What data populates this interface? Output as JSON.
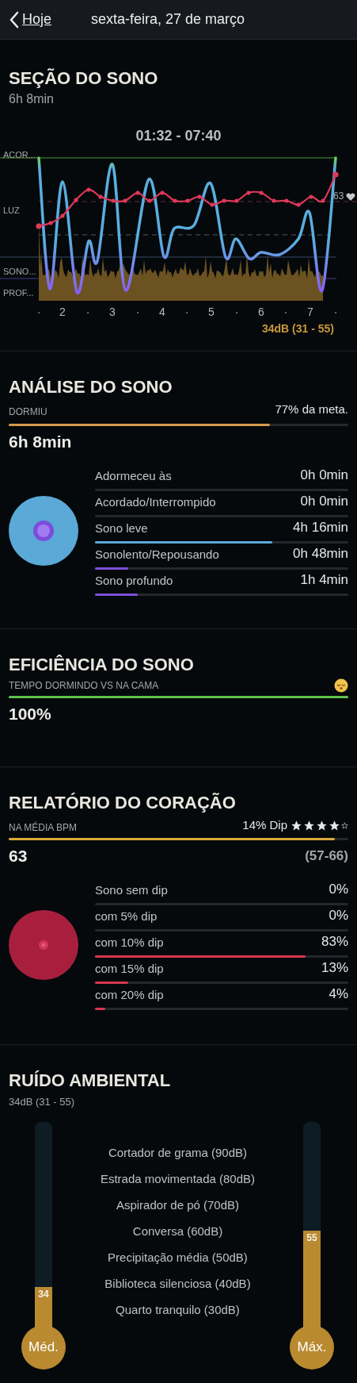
{
  "header": {
    "back_label": "Hoje",
    "title": "sexta-feira, 27 de março"
  },
  "sleep_session": {
    "title": "SEÇÃO DO SONO",
    "duration": "6h 8min",
    "time_range": "01:32 - 07:40",
    "stage_labels": [
      "ACOR...",
      "LUZ",
      "SONO...",
      "PROF..."
    ],
    "x_labels": [
      "·",
      "2",
      "·",
      "3",
      "·",
      "4",
      "·",
      "5",
      "·",
      "6",
      "·",
      "7",
      "·"
    ],
    "heart_label": "63",
    "noise_label": "34dB (31 - 55)"
  },
  "sleep_analysis": {
    "title": "ANÁLISE DO SONO",
    "label": "DORMIU",
    "goal": "77% da meta.",
    "level": 0.77,
    "total": "6h 8min",
    "rows": [
      {
        "label": "Adormeceu às",
        "value": "0h 0min",
        "level": 0
      },
      {
        "label": "Acordado/Interrompido",
        "value": "0h 0min",
        "level": 0
      },
      {
        "label": "Sono leve",
        "value": "4h 16min",
        "level": 0.7,
        "color": "#5aa9d6"
      },
      {
        "label": "Sonolento/Repousando",
        "value": "0h 48min",
        "level": 0.13,
        "color": "#7c4ddb"
      },
      {
        "label": "Sono profundo",
        "value": "1h 4min",
        "level": 0.17,
        "color": "#7c4ddb"
      }
    ]
  },
  "sleep_efficiency": {
    "title": "EFICIÊNCIA DO SONO",
    "label": "TEMPO DORMINDO VS NA CAMA",
    "level": 1,
    "value": "100%"
  },
  "heart_report": {
    "title": "RELATÓRIO DO CORAÇÃO",
    "label": "NA MÉDIA BPM",
    "dip": "14% Dip",
    "stars": 4,
    "level": 0.96,
    "value": "63",
    "range": "(57-66)",
    "rows": [
      {
        "label": "Sono sem dip",
        "value": "0%",
        "level": 0
      },
      {
        "label": "com 5% dip",
        "value": "0%",
        "level": 0
      },
      {
        "label": "com 10% dip",
        "value": "83%",
        "level": 0.83
      },
      {
        "label": "com 15% dip",
        "value": "13%",
        "level": 0.13
      },
      {
        "label": "com 20% dip",
        "value": "4%",
        "level": 0.04
      }
    ]
  },
  "ambient_noise": {
    "title": "RUÍDO AMBIENTAL",
    "subtitle": "34dB (31 - 55)",
    "average": {
      "value": "34",
      "label": "Méd.",
      "level": 0.21
    },
    "max": {
      "value": "55",
      "label": "Máx.",
      "level": 0.48
    },
    "references": [
      "Cortador de grama (90dB)",
      "Estrada movimentada (80dB)",
      "Aspirador de pó (70dB)",
      "Conversa (60dB)",
      "Precipitação média (50dB)",
      "Biblioteca silenciosa (40dB)",
      "Quarto tranquilo (30dB)"
    ]
  }
}
